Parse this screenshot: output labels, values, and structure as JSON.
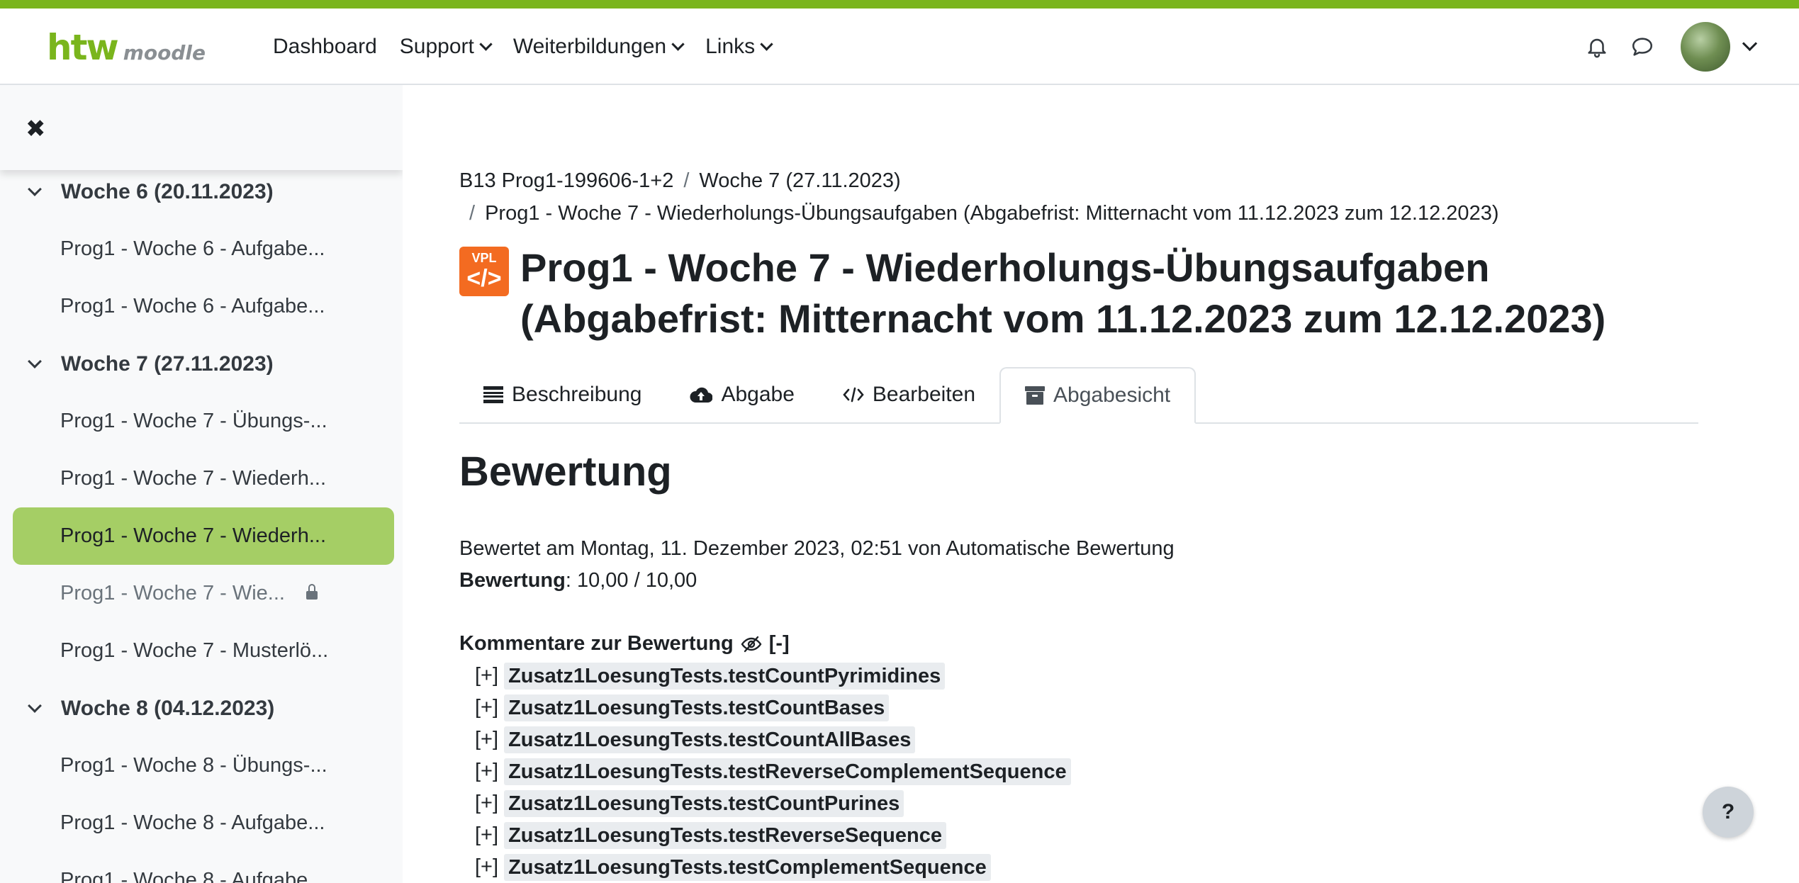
{
  "brand": {
    "logo_main": "htw",
    "logo_sub": "moodle",
    "accent_color": "#7ab51d"
  },
  "nav": {
    "items": [
      {
        "label": "Dashboard",
        "dropdown": false
      },
      {
        "label": "Support",
        "dropdown": true
      },
      {
        "label": "Weiterbildungen",
        "dropdown": true
      },
      {
        "label": "Links",
        "dropdown": true
      }
    ],
    "icons": [
      "bell-icon",
      "chat-icon"
    ]
  },
  "drawer": {
    "close_glyph": "✖",
    "items": [
      {
        "type": "section",
        "label": "Woche 6 (20.11.2023)"
      },
      {
        "type": "activity",
        "label": "Prog1 - Woche 6 - Aufgabe..."
      },
      {
        "type": "activity",
        "label": "Prog1 - Woche 6 - Aufgabe..."
      },
      {
        "type": "section",
        "label": "Woche 7 (27.11.2023)"
      },
      {
        "type": "activity",
        "label": "Prog1 - Woche 7 - Übungs-..."
      },
      {
        "type": "activity",
        "label": "Prog1 - Woche 7 - Wiederh..."
      },
      {
        "type": "activity",
        "label": "Prog1 - Woche 7 - Wiederh...",
        "active": true
      },
      {
        "type": "activity",
        "label": "Prog1 - Woche 7 - Wie...",
        "restricted": true
      },
      {
        "type": "activity",
        "label": "Prog1 - Woche 7 - Musterlö..."
      },
      {
        "type": "section",
        "label": "Woche 8 (04.12.2023)"
      },
      {
        "type": "activity",
        "label": "Prog1 - Woche 8 - Übungs-..."
      },
      {
        "type": "activity",
        "label": "Prog1 - Woche 8 - Aufgabe..."
      },
      {
        "type": "activity",
        "label": "Prog1 - Woche 8 - Aufgabe..."
      }
    ]
  },
  "breadcrumb": {
    "course": "B13 Prog1-199606-1+2",
    "section": "Woche 7 (27.11.2023)",
    "activity": "Prog1 - Woche 7 - Wiederholungs-Übungsaufgaben (Abgabefrist: Mitternacht vom 11.12.2023 zum 12.12.2023)",
    "separator": "/"
  },
  "page": {
    "icon_text": "VPL",
    "icon_code": "</>",
    "title_line1": "Prog1 - Woche 7 - Wiederholungs-Übungsaufgaben",
    "title_line2": "(Abgabefrist: Mitternacht vom 11.12.2023 zum 12.12.2023)"
  },
  "tabs": [
    {
      "label": "Beschreibung",
      "icon": "list-icon"
    },
    {
      "label": "Abgabe",
      "icon": "cloud-upload-icon"
    },
    {
      "label": "Bearbeiten",
      "icon": "code-icon"
    },
    {
      "label": "Abgabesicht",
      "icon": "archive-icon",
      "active": true
    }
  ],
  "grading": {
    "heading": "Bewertung",
    "graded_line": "Bewertet am Montag, 11. Dezember 2023, 02:51 von Automatische Bewertung",
    "grade_label": "Bewertung",
    "grade_value": ": 10,00 / 10,00"
  },
  "comments": {
    "heading": "Kommentare zur Bewertung",
    "collapse": "[-]",
    "expand": "[+]",
    "tests": [
      "Zusatz1LoesungTests.testCountPyrimidines",
      "Zusatz1LoesungTests.testCountBases",
      "Zusatz1LoesungTests.testCountAllBases",
      "Zusatz1LoesungTests.testReverseComplementSequence",
      "Zusatz1LoesungTests.testCountPurines",
      "Zusatz1LoesungTests.testReverseSequence",
      "Zusatz1LoesungTests.testComplementSequence"
    ]
  },
  "help": {
    "label": "?"
  }
}
